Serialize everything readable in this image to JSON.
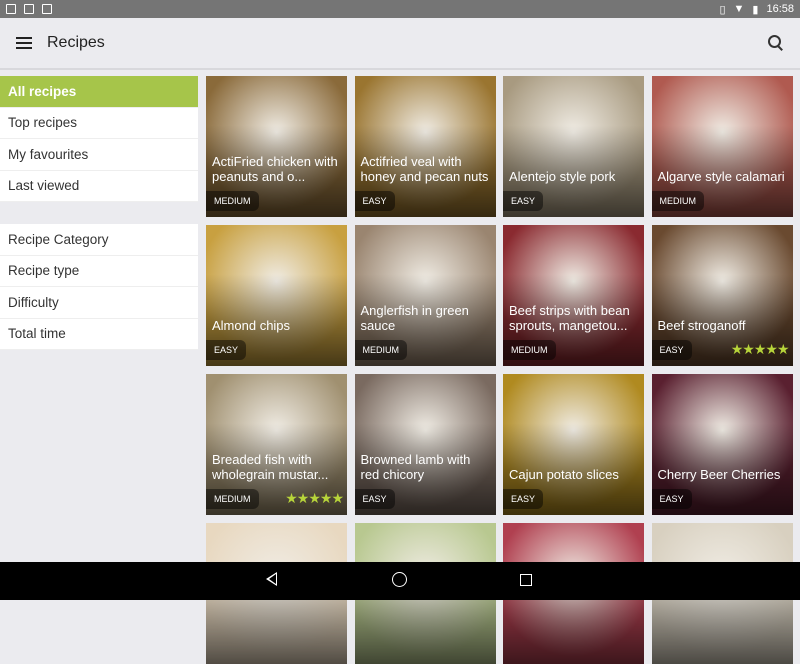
{
  "status_bar": {
    "time": "16:58",
    "left_icons": [
      "photo-icon",
      "gmail-icon",
      "clipboard-icon"
    ],
    "right_icons": [
      "vibrate-icon",
      "wifi-icon",
      "battery-icon"
    ]
  },
  "app_bar": {
    "title": "Recipes"
  },
  "sidebar": {
    "groups": [
      [
        {
          "label": "All recipes",
          "active": true
        },
        {
          "label": "Top recipes"
        },
        {
          "label": "My favourites"
        },
        {
          "label": "Last viewed"
        }
      ],
      [
        {
          "label": "Recipe Category"
        },
        {
          "label": "Recipe type"
        },
        {
          "label": "Difficulty"
        },
        {
          "label": "Total time"
        }
      ]
    ]
  },
  "recipes": [
    {
      "name": "ActiFried chicken with peanuts and o...",
      "difficulty": "MEDIUM",
      "stars": 0,
      "color": "#8a6a3a"
    },
    {
      "name": "Actifried veal with honey and pecan nuts",
      "difficulty": "EASY",
      "stars": 0,
      "color": "#9a7530"
    },
    {
      "name": "Alentejo style pork",
      "difficulty": "EASY",
      "stars": 0,
      "color": "#a89a80"
    },
    {
      "name": "Algarve style calamari",
      "difficulty": "MEDIUM",
      "stars": 0,
      "color": "#b05a50"
    },
    {
      "name": "Almond chips",
      "difficulty": "EASY",
      "stars": 0,
      "color": "#c8a040"
    },
    {
      "name": "Anglerfish in green sauce",
      "difficulty": "MEDIUM",
      "stars": 0,
      "color": "#9a8570"
    },
    {
      "name": "Beef strips with bean sprouts, mangetou...",
      "difficulty": "MEDIUM",
      "stars": 0,
      "color": "#8a2a30"
    },
    {
      "name": "Beef stroganoff",
      "difficulty": "EASY",
      "stars": 5,
      "color": "#6a4a30"
    },
    {
      "name": "Breaded fish with wholegrain mustar...",
      "difficulty": "MEDIUM",
      "stars": 5,
      "color": "#a09070"
    },
    {
      "name": "Browned lamb with red chicory",
      "difficulty": "EASY",
      "stars": 0,
      "color": "#7a6a60"
    },
    {
      "name": "Cajun potato slices",
      "difficulty": "EASY",
      "stars": 0,
      "color": "#b08a20"
    },
    {
      "name": "Cherry Beer Cherries",
      "difficulty": "EASY",
      "stars": 0,
      "color": "#5a2030"
    },
    {
      "name": "",
      "difficulty": "",
      "stars": 0,
      "color": "#e8d8c0"
    },
    {
      "name": "",
      "difficulty": "",
      "stars": 0,
      "color": "#b8c890"
    },
    {
      "name": "",
      "difficulty": "",
      "stars": 0,
      "color": "#b04050"
    },
    {
      "name": "",
      "difficulty": "",
      "stars": 0,
      "color": "#d8d0c0"
    }
  ],
  "nav": {
    "back": "back-button",
    "home": "home-button",
    "recents": "recents-button"
  }
}
